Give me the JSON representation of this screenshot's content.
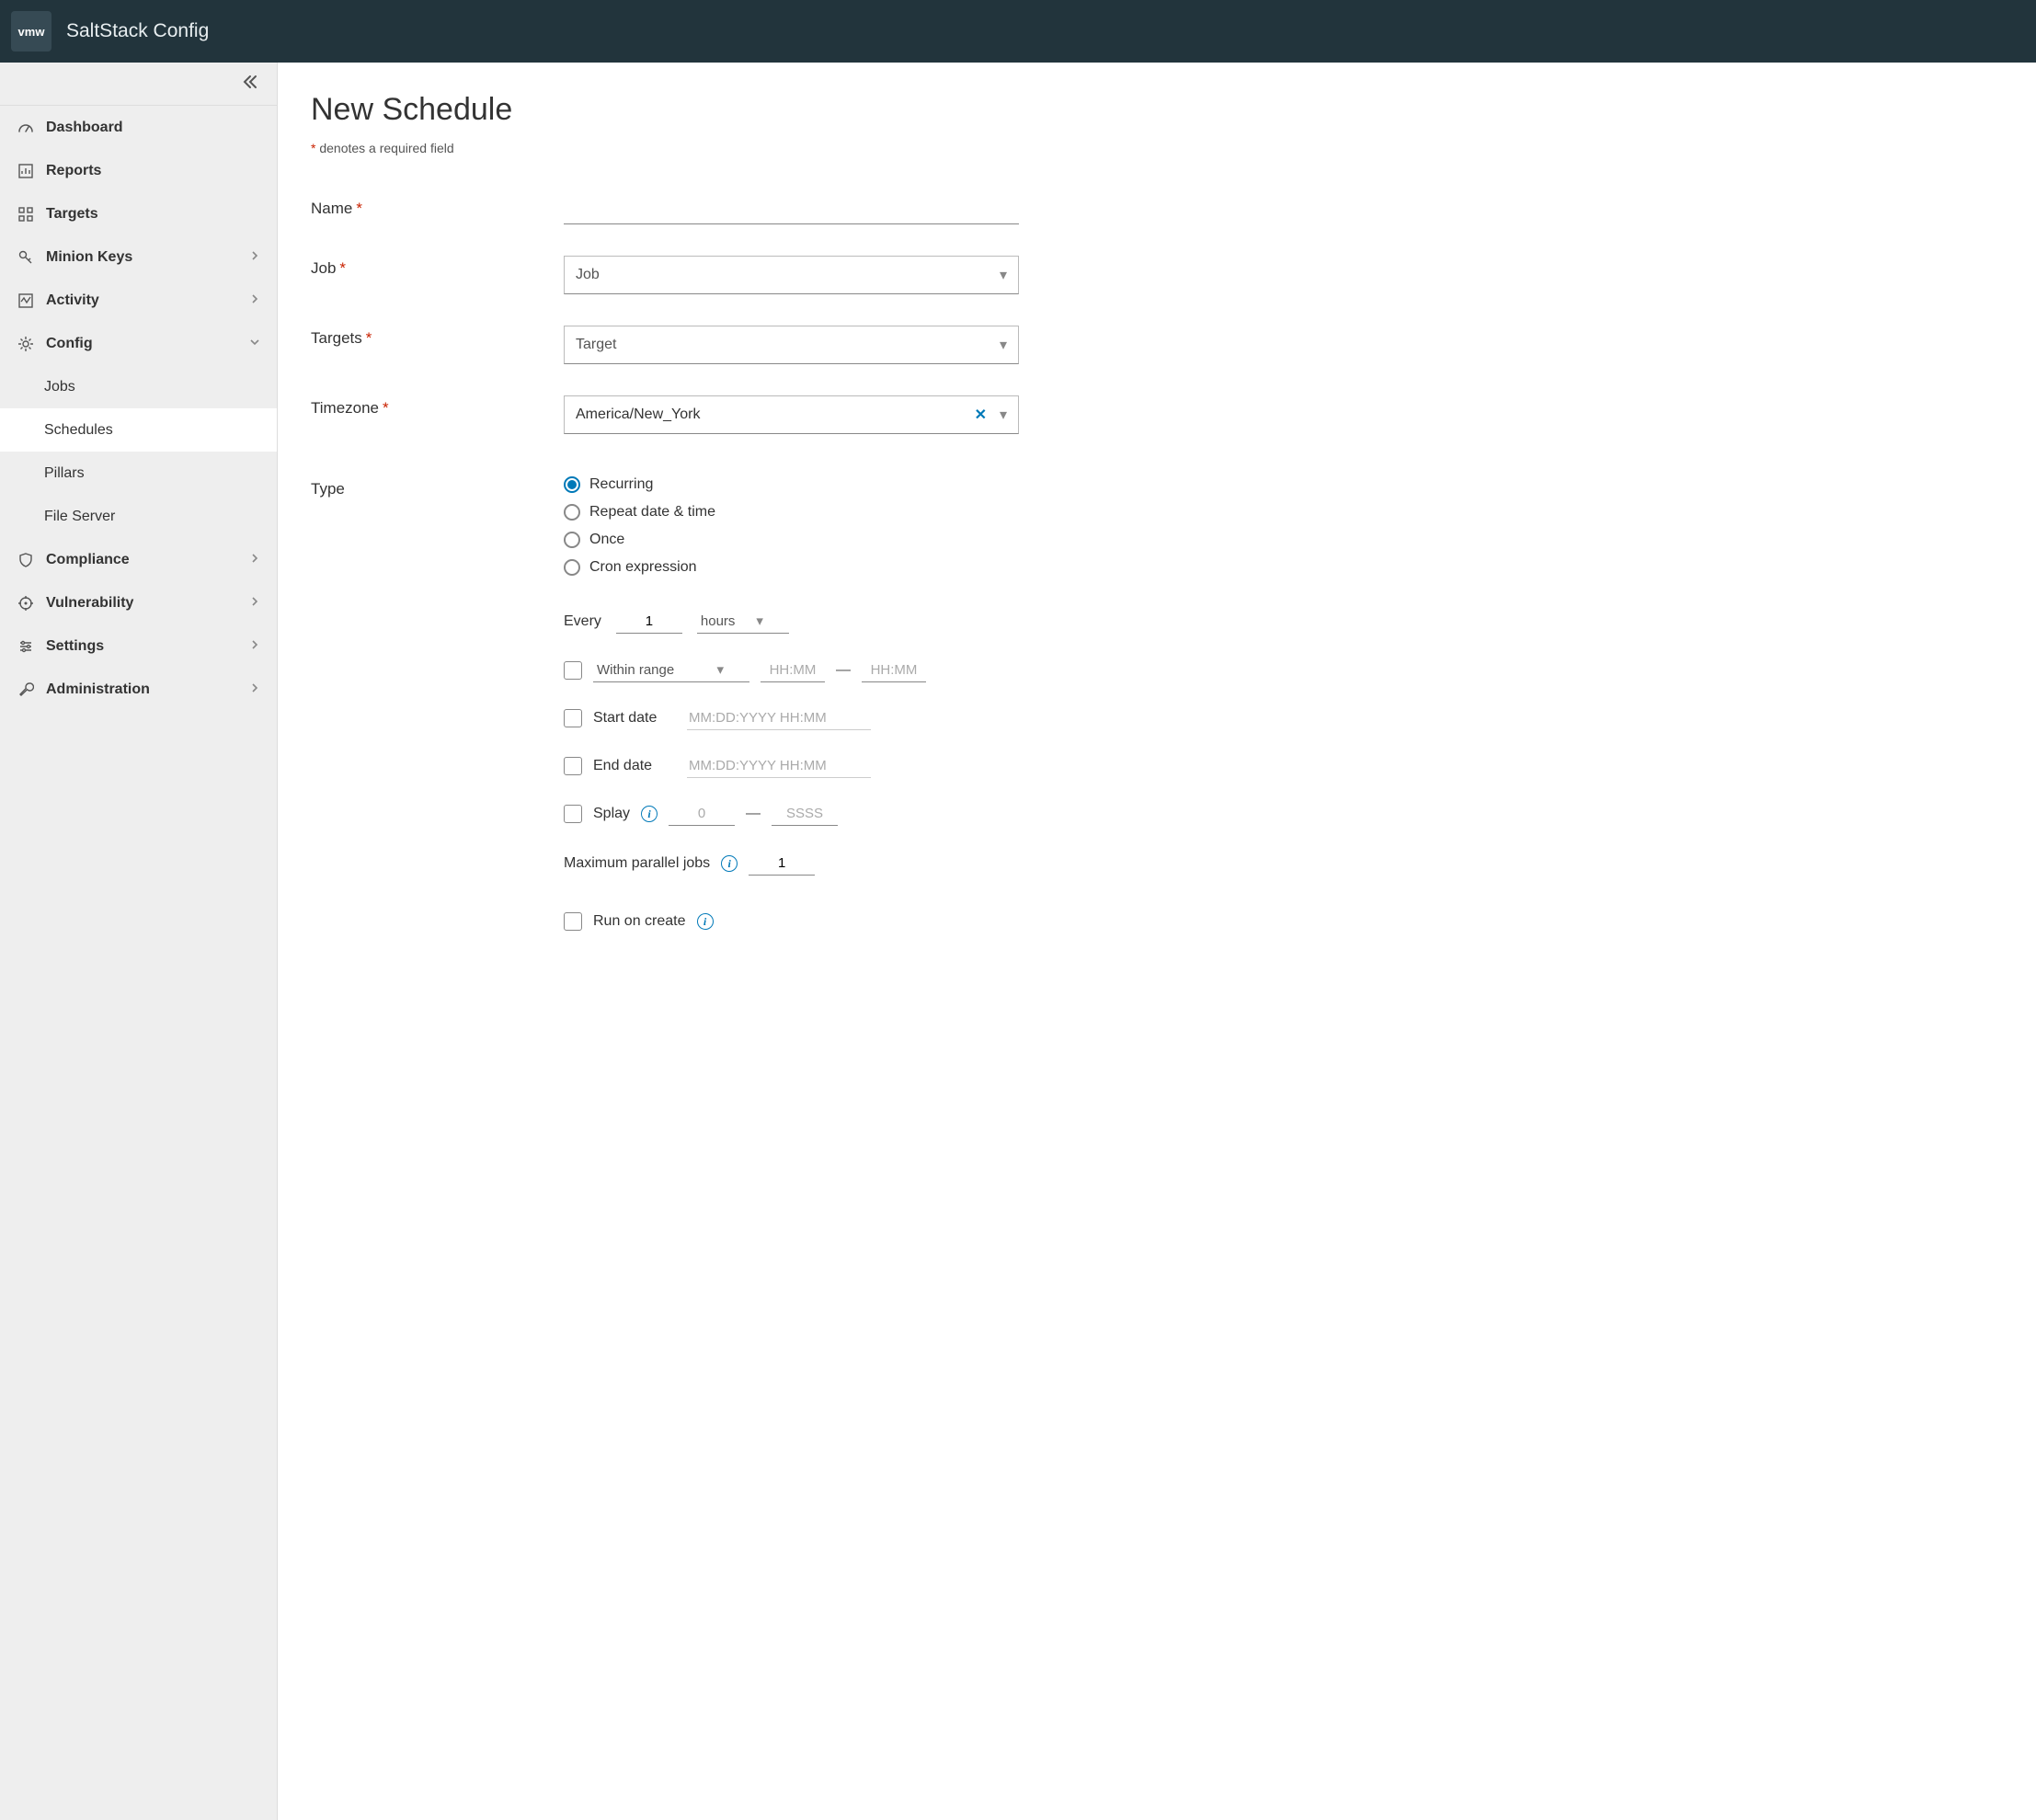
{
  "header": {
    "logo": "vmw",
    "title": "SaltStack Config"
  },
  "sidebar": {
    "dashboard": "Dashboard",
    "reports": "Reports",
    "targets": "Targets",
    "minion_keys": "Minion Keys",
    "activity": "Activity",
    "config": "Config",
    "config_children": {
      "jobs": "Jobs",
      "schedules": "Schedules",
      "pillars": "Pillars",
      "file_server": "File Server"
    },
    "compliance": "Compliance",
    "vulnerability": "Vulnerability",
    "settings": "Settings",
    "administration": "Administration"
  },
  "page": {
    "title": "New Schedule",
    "required_note": " denotes a required field",
    "asterisk": "*"
  },
  "form": {
    "name_label": "Name",
    "job_label": "Job",
    "job_value": "Job",
    "targets_label": "Targets",
    "targets_value": "Target",
    "timezone_label": "Timezone",
    "timezone_value": "America/New_York",
    "type_label": "Type",
    "type_options": {
      "recurring": "Recurring",
      "repeat": "Repeat date & time",
      "once": "Once",
      "cron": "Cron expression"
    },
    "every_label": "Every",
    "every_value": "1",
    "every_unit": "hours",
    "within_range_label": "Within range",
    "hhmm_placeholder": "HH:MM",
    "range_dash": "—",
    "start_date_label": "Start date",
    "end_date_label": "End date",
    "date_placeholder": "MM:DD:YYYY HH:MM",
    "splay_label": "Splay",
    "splay_from_placeholder": "0",
    "splay_to_placeholder": "SSSS",
    "max_parallel_label": "Maximum parallel jobs",
    "max_parallel_value": "1",
    "run_on_create_label": "Run on create",
    "clear_x": "✕"
  }
}
